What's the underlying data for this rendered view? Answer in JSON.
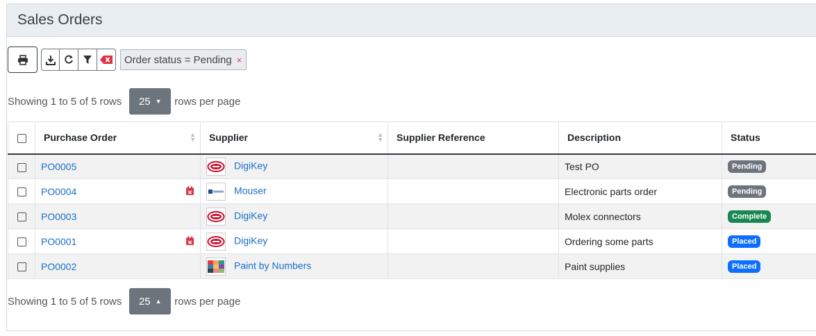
{
  "header": {
    "title": "Sales Orders"
  },
  "toolbar": {
    "buttons": [
      {
        "name": "print",
        "icon": "print-icon"
      },
      {
        "name": "download",
        "icon": "download-icon"
      },
      {
        "name": "refresh",
        "icon": "refresh-icon"
      },
      {
        "name": "filter",
        "icon": "filter-icon"
      },
      {
        "name": "clear-filters",
        "icon": "clear-filter-icon"
      }
    ],
    "filter_chip": {
      "label": "Order status = Pending",
      "remove": "×"
    }
  },
  "pagination": {
    "info": "Showing 1 to 5 of 5 rows",
    "page_size": "25",
    "suffix": "rows per page"
  },
  "table": {
    "columns": [
      "Purchase Order",
      "Supplier",
      "Supplier Reference",
      "Description",
      "Status"
    ],
    "rows": [
      {
        "po": "PO0005",
        "overdue": false,
        "supplier": "DigiKey",
        "logo": "digikey",
        "reference": "",
        "description": "Test PO",
        "status": "Pending"
      },
      {
        "po": "PO0004",
        "overdue": true,
        "supplier": "Mouser",
        "logo": "mouser",
        "reference": "",
        "description": "Electronic parts order",
        "status": "Pending"
      },
      {
        "po": "PO0003",
        "overdue": false,
        "supplier": "DigiKey",
        "logo": "digikey",
        "reference": "",
        "description": "Molex connectors",
        "status": "Complete"
      },
      {
        "po": "PO0001",
        "overdue": true,
        "supplier": "DigiKey",
        "logo": "digikey",
        "reference": "",
        "description": "Ordering some parts",
        "status": "Placed"
      },
      {
        "po": "PO0002",
        "overdue": false,
        "supplier": "Paint by Numbers",
        "logo": "paint",
        "reference": "",
        "description": "Paint supplies",
        "status": "Placed"
      }
    ]
  },
  "colors": {
    "Pending": "#6c757d",
    "Complete": "#198754",
    "Placed": "#0d6efd",
    "link": "#1a6fc9",
    "overdue_icon": "#dc3545"
  }
}
